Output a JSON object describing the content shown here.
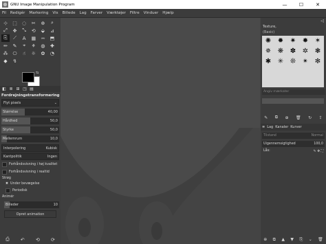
{
  "window": {
    "title": "GNU Image Manipulation Program",
    "minimize_glyph": "—",
    "maximize_glyph": "☐",
    "close_glyph": "✕"
  },
  "menu": [
    "Fil",
    "Redigér",
    "Markering",
    "Vis",
    "Billede",
    "Lag",
    "Farver",
    "Værktøjer",
    "Filtre",
    "Vinduer",
    "Hjælp"
  ],
  "toolbox": {
    "tools": [
      "⊹",
      "⬚",
      "◌",
      "✂",
      "⊕",
      "⌕",
      "⤢",
      "✥",
      "⤡",
      "⟲",
      "⬙",
      "⊿",
      "⎘",
      "⟋",
      "A",
      "▦",
      "⇿",
      "⬒",
      "✏",
      "✎",
      "⌖",
      "⚘",
      "◍",
      "✚",
      "⁂",
      "⎔",
      "☝",
      "☼",
      "✿",
      "◔",
      "◆",
      "↯"
    ],
    "active_index": 12
  },
  "colors": {
    "foreground": "#000000",
    "background": "#ffffff",
    "swap_glyph": "⇆"
  },
  "tool_options": {
    "tab_icons": [
      "◧",
      "≣",
      "⊞",
      "◳",
      "▤"
    ],
    "title": "Fordrejningstransformering",
    "mode": "Flyt pixels",
    "sliders": [
      {
        "label": "Størrelse",
        "value": "40,00",
        "fill_fraction": 0.4
      },
      {
        "label": "Hårdhed",
        "value": "50,0",
        "fill_fraction": 0.5
      },
      {
        "label": "Styrke",
        "value": "50,0",
        "fill_fraction": 0.5
      },
      {
        "label": "Mellemrum",
        "value": "10,0",
        "fill_fraction": 0.1
      }
    ],
    "interpolation_label": "Interpolering",
    "interpolation_value": "Kubisk",
    "abyss_label": "Kantpolitik",
    "abyss_value": "Ingen",
    "check_high_quality": "Forhåndsvisning i høj kvalitet",
    "check_realtime": "Forhåndsvisning i realtid",
    "strokes_label": "Strøg",
    "check_during_motion": "Under bevægelse",
    "check_periodic": "Periodisk",
    "animate_label": "Animér",
    "frames_label": "Billeder",
    "frames_value": "10",
    "create_animation_button": "Opret animation",
    "bottom_icons": [
      "⎙",
      "↶",
      "⟲",
      "⟳"
    ]
  },
  "brushes": {
    "title": "Texture,",
    "subtitle": "(Basic)",
    "glyphs": [
      "✺",
      "✹",
      "✷",
      "✸",
      "✶",
      "✵",
      "❋",
      "✽",
      "✲",
      "❃",
      "✱",
      "✳",
      "❊",
      "✴",
      "✻"
    ],
    "tag_placeholder": "Angiv mærkater",
    "bottom_icons": [
      "✎",
      "⧉",
      "⊕",
      "🗑",
      "↻",
      "⇪"
    ]
  },
  "layers": {
    "tabs": [
      "Lag",
      "Kanaler",
      "Kurver"
    ],
    "mode_label": "Tilstand",
    "mode_value": "Normal",
    "opacity_label": "Uigennemsigtighed",
    "opacity_value": "100,0",
    "lock_label": "Lås:",
    "bottom_icons": [
      "⊕",
      "⧉",
      "▲",
      "▼",
      "⎘",
      "⌄",
      "🗑"
    ]
  },
  "watermark_color": "#3f3f3f",
  "accent_color": "#4a4a4a"
}
